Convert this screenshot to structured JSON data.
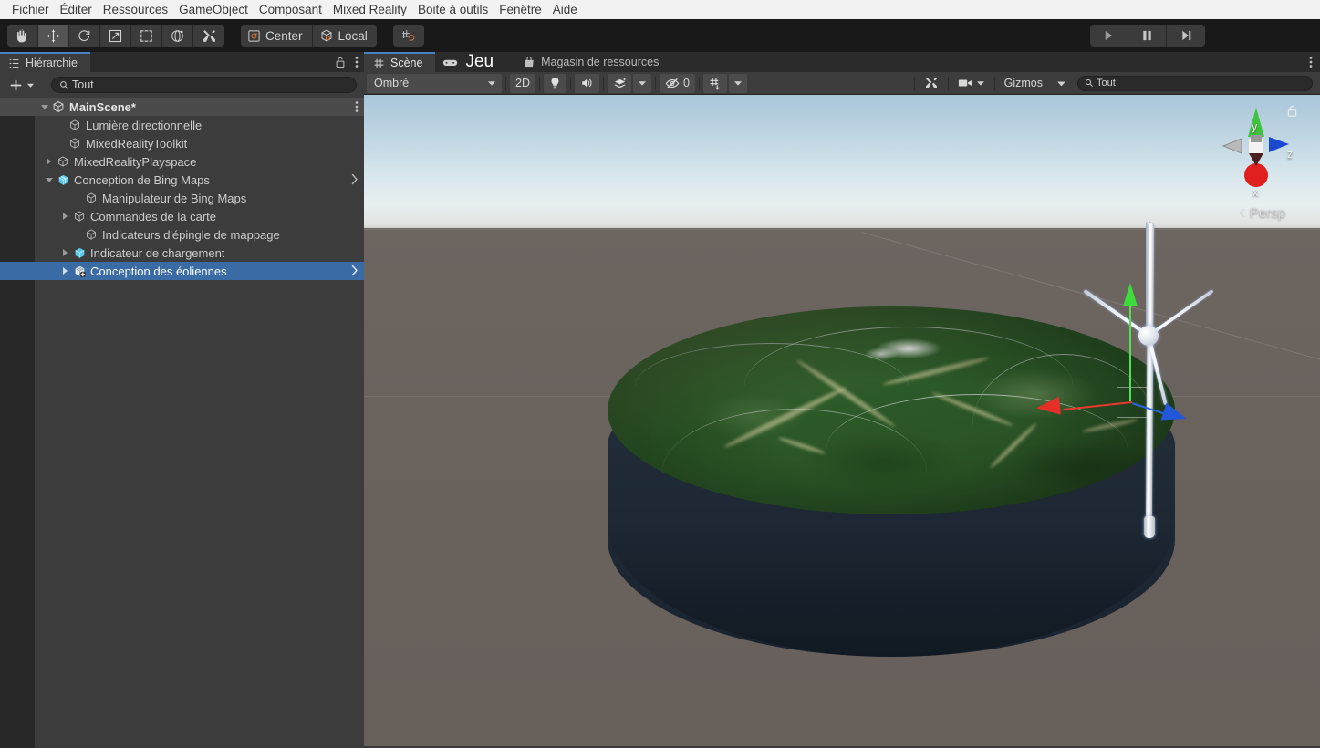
{
  "menubar": {
    "items": [
      {
        "label": "Fichier"
      },
      {
        "label": "Éditer"
      },
      {
        "label": "Ressources"
      },
      {
        "label": "GameObject"
      },
      {
        "label": "Composant"
      },
      {
        "label": "Mixed Reality"
      },
      {
        "label": "Boite à outils"
      },
      {
        "label": "Fenêtre"
      },
      {
        "label": "Aide"
      }
    ]
  },
  "toolbar": {
    "tools": [
      {
        "name": "hand-tool",
        "selected": false
      },
      {
        "name": "move-tool",
        "selected": true
      },
      {
        "name": "rotate-tool",
        "selected": false
      },
      {
        "name": "scale-tool",
        "selected": false
      },
      {
        "name": "rect-tool",
        "selected": false
      },
      {
        "name": "transform-tool",
        "selected": false
      },
      {
        "name": "custom-tool",
        "selected": false
      }
    ],
    "pivot_label": "Center",
    "space_label": "Local",
    "snap_label": "",
    "play_label": "",
    "pause_label": "",
    "step_label": ""
  },
  "hierarchy": {
    "tab_label": "Hiérarchie",
    "search_value": "Tout",
    "search_placeholder": "Tout",
    "add_label": "+",
    "items": [
      {
        "label": "MainScene*",
        "depth": 0,
        "twisty": "down",
        "icon": "scene-icon",
        "kind": "scene",
        "selected": false,
        "chevron": false
      },
      {
        "label": "Lumière directionnelle",
        "depth": 2,
        "twisty": "none",
        "icon": "gameobject-icon",
        "kind": "object",
        "selected": false,
        "chevron": false
      },
      {
        "label": "MixedRealityToolkit",
        "depth": 2,
        "twisty": "none",
        "icon": "gameobject-icon",
        "kind": "object",
        "selected": false,
        "chevron": false
      },
      {
        "label": "MixedRealityPlayspace",
        "depth": 2,
        "twisty": "right",
        "icon": "gameobject-icon",
        "kind": "object",
        "selected": false,
        "chevron": false
      },
      {
        "label": "Conception de Bing Maps",
        "depth": 2,
        "twisty": "down",
        "icon": "prefab-variant-icon",
        "kind": "prefab",
        "selected": false,
        "chevron": true
      },
      {
        "label": "Manipulateur de Bing Maps",
        "depth": 3,
        "twisty": "none",
        "icon": "gameobject-icon",
        "kind": "object",
        "selected": false,
        "chevron": false
      },
      {
        "label": "Commandes de la carte",
        "depth": 3,
        "twisty": "right",
        "icon": "gameobject-icon",
        "kind": "object",
        "selected": false,
        "chevron": false
      },
      {
        "label": "Indicateurs d'épingle de mappage",
        "depth": 3,
        "twisty": "none",
        "icon": "gameobject-icon",
        "kind": "object",
        "selected": false,
        "chevron": false
      },
      {
        "label": "Indicateur de chargement",
        "depth": 3,
        "twisty": "right",
        "icon": "prefab-icon",
        "kind": "prefab",
        "selected": false,
        "chevron": false
      },
      {
        "label": "Conception des éoliennes",
        "depth": 3,
        "twisty": "right",
        "icon": "prefab-variant-icon",
        "kind": "prefab",
        "selected": true,
        "chevron": true
      }
    ]
  },
  "scene": {
    "tabs": [
      {
        "label": "Scène",
        "icon": "grid-icon",
        "active": true
      },
      {
        "label": "Jeu",
        "icon": "gamepad-icon",
        "active": false
      },
      {
        "label": "Magasin de ressources",
        "icon": "store-icon",
        "active": false
      }
    ],
    "toolbar": {
      "draw_mode": "Ombré",
      "mode_2d": "2D",
      "lighting": "lighting-icon",
      "audio": "audio-icon",
      "fx": "fx-icon",
      "hidden_count": "0",
      "grid": "grid-snap-icon",
      "tools": "tools-icon",
      "camera": "camera-icon",
      "gizmos_label": "Gizmos",
      "search_value": "Tout",
      "search_placeholder": "Tout"
    },
    "view_gizmo": {
      "x_label": "x",
      "y_label": "y",
      "z_label": "z",
      "projection_label": "Persp"
    }
  },
  "colors": {
    "accent_blue": "#3a6ba5",
    "tab_accent": "#4a80c4",
    "pivot_orange": "#e07b39",
    "axis_x": "#e43026",
    "axis_y": "#3ddc3d",
    "axis_z": "#2257d8",
    "panel_bg": "#3c3c3c",
    "toolbar_bg": "#191919",
    "menubar_bg": "#f2f2f2",
    "ground": "#68605b",
    "disc_side": "#1e2935"
  }
}
